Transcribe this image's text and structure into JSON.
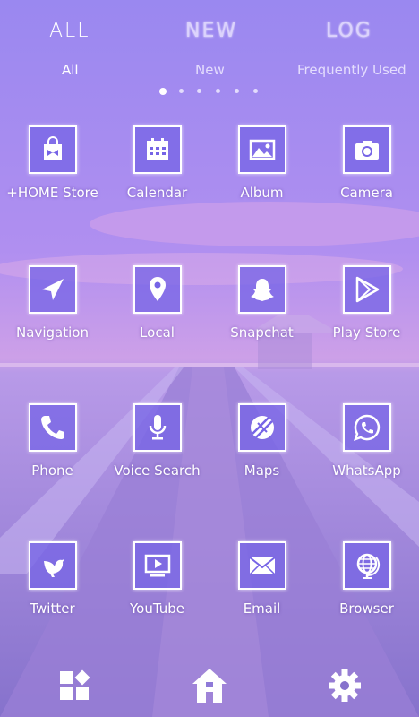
{
  "header": {
    "tabs": [
      {
        "title": "ALL",
        "subtitle": "All",
        "active": true
      },
      {
        "title": "NEW",
        "subtitle": "New",
        "active": false
      },
      {
        "title": "LOG",
        "subtitle": "Frequently Used",
        "active": false
      }
    ],
    "page_indicator": {
      "pages": 6,
      "current": 1
    }
  },
  "apps": [
    {
      "label": "+HOME Store",
      "icon": "store-bag-icon"
    },
    {
      "label": "Calendar",
      "icon": "calendar-icon"
    },
    {
      "label": "Album",
      "icon": "album-image-icon"
    },
    {
      "label": "Camera",
      "icon": "camera-icon"
    },
    {
      "label": "Navigation",
      "icon": "navigation-arrow-icon"
    },
    {
      "label": "Local",
      "icon": "map-pin-icon"
    },
    {
      "label": "Snapchat",
      "icon": "snapchat-ghost-icon"
    },
    {
      "label": "Play Store",
      "icon": "play-store-icon"
    },
    {
      "label": "Phone",
      "icon": "phone-icon"
    },
    {
      "label": "Voice Search",
      "icon": "microphone-icon"
    },
    {
      "label": "Maps",
      "icon": "maps-icon"
    },
    {
      "label": "WhatsApp",
      "icon": "whatsapp-icon"
    },
    {
      "label": "Twitter",
      "icon": "twitter-bird-icon"
    },
    {
      "label": "YouTube",
      "icon": "youtube-video-icon"
    },
    {
      "label": "Email",
      "icon": "email-envelope-icon"
    },
    {
      "label": "Browser",
      "icon": "globe-icon"
    }
  ],
  "dock": [
    {
      "name": "widgets-icon"
    },
    {
      "name": "home-icon"
    },
    {
      "name": "settings-gear-icon"
    }
  ],
  "colors": {
    "tile_fill": "#7664e6",
    "tile_border": "#ffffff",
    "text": "#ffffff"
  }
}
